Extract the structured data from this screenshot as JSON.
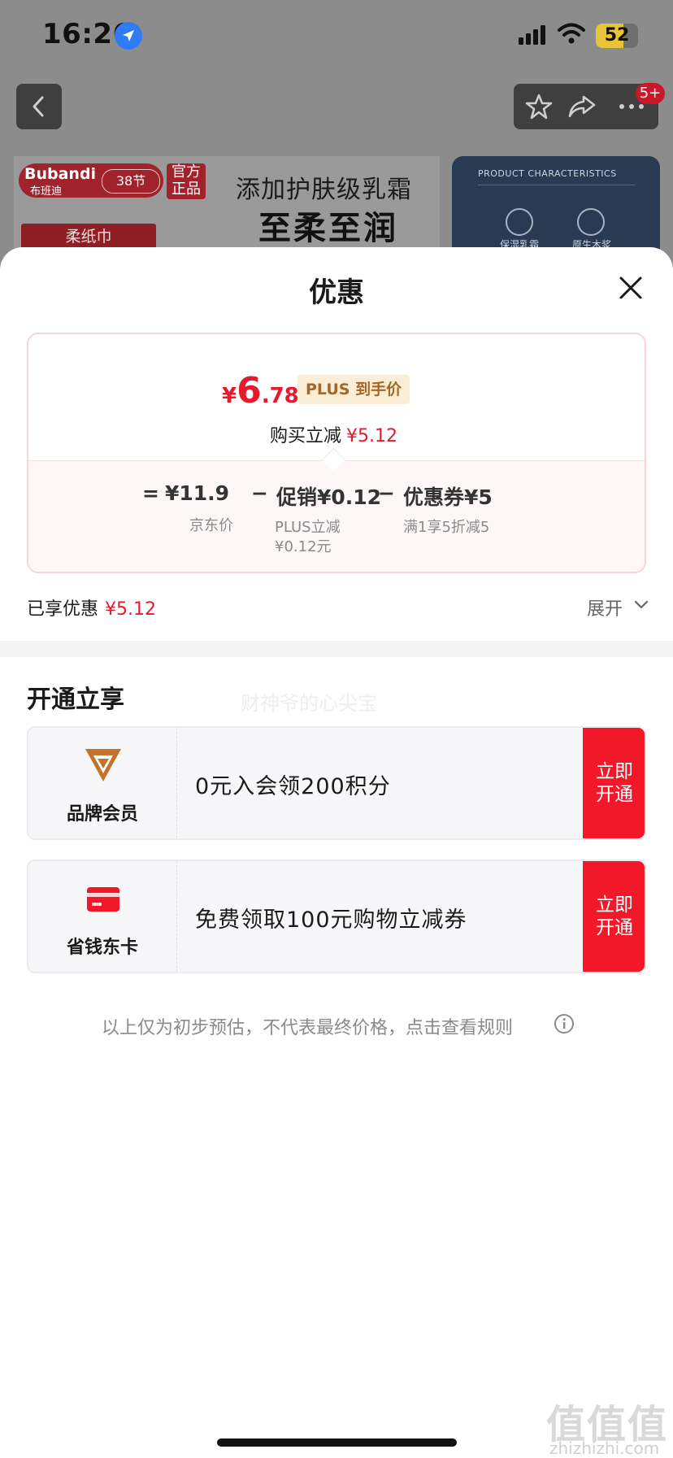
{
  "status_bar": {
    "time": "16:26",
    "battery": "52",
    "icons": [
      "location-arrow-icon",
      "cellular-signal-icon",
      "wifi-icon",
      "battery-icon"
    ]
  },
  "nav": {
    "badge": "5+",
    "icons": [
      "back-chevron-icon",
      "star-icon",
      "share-icon",
      "more-icon"
    ]
  },
  "banner": {
    "brand": "Bubandi",
    "brand_cn": "布班迪",
    "festival": "38节",
    "official": "官方正品",
    "product_tag": "柔纸巾",
    "headline": "添加护肤级乳霜",
    "slogan": "至柔至润",
    "right_title": "PRODUCT CHARACTERISTICS",
    "right_items": [
      "保湿乳霜",
      "原生木浆"
    ]
  },
  "sheet": {
    "title": "优惠",
    "price": {
      "currency": "¥",
      "integer": "6",
      "decimal": ".78",
      "plus_tag": "PLUS 到手价"
    },
    "buy_reduce": {
      "label": "购买立减",
      "amount": "¥5.12"
    },
    "formula": {
      "equals": "=",
      "minus1": "−",
      "minus2": "−",
      "base_price": "¥11.9",
      "base_label": "京东价",
      "promo": "促销¥0.12",
      "promo_label_1": "PLUS立减",
      "promo_label_2": "¥0.12元",
      "coupon": "优惠券¥5",
      "coupon_label": "满1享5折减5"
    },
    "enjoyed": {
      "label": "已享优惠",
      "amount": "¥5.12"
    },
    "expand": "展开",
    "section_title": "开通立享",
    "watermark": "财神爷的心尖宝",
    "offers": [
      {
        "name": "品牌会员",
        "icon": "brand-v-logo-icon",
        "desc": "0元入会领200积分",
        "button": "立即开通"
      },
      {
        "name": "省钱东卡",
        "icon": "red-card-icon",
        "desc": "免费领取100元购物立减券",
        "button": "立即开通"
      }
    ],
    "disclaimer": "以上仅为初步预估，不代表最终价格，点击查看规则"
  },
  "site_mark": {
    "text": "值值值",
    "sub": "zhizhizhi.com"
  },
  "colors": {
    "accent_red": "#e8192c",
    "button_red": "#f2182a",
    "plus_gold": "#a3672b",
    "plus_bg": "#fbeed6",
    "brand_red": "#a0222b"
  }
}
